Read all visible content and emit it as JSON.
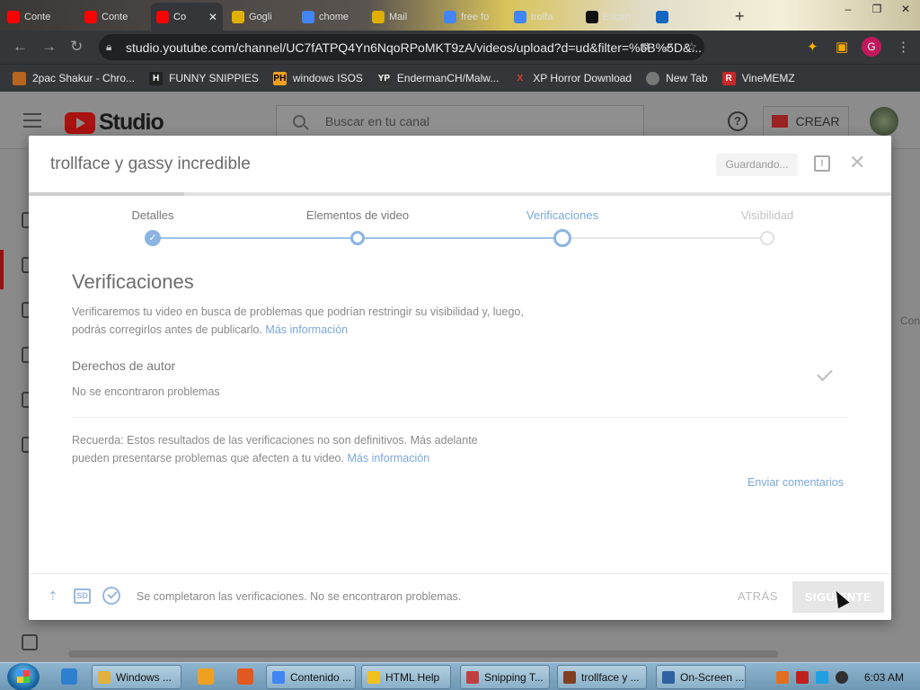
{
  "browser": {
    "tabs": [
      {
        "label": "Conte",
        "color": "#ff0000"
      },
      {
        "label": "Conte",
        "color": "#ff0000"
      },
      {
        "label": "Co",
        "color": "#ff0000",
        "active": true
      },
      {
        "label": "Gogli",
        "color": "#e0b000"
      },
      {
        "label": "chome",
        "color": "#4285f4"
      },
      {
        "label": "Mail",
        "color": "#e0b000"
      },
      {
        "label": "free fo",
        "color": "#4285f4"
      },
      {
        "label": "trolfa",
        "color": "#4285f4"
      },
      {
        "label": "Escap",
        "color": "#111111"
      },
      {
        "label": "",
        "color": "#1565c0"
      }
    ],
    "new_tab": "+",
    "window_buttons": {
      "minimize": "–",
      "maximize": "❐",
      "close": "✕"
    },
    "url": "studio.youtube.com/channel/UC7fATPQ4Yn6NqoRPoMKT9zA/videos/upload?d=ud&filter=%5B%5D&...",
    "profile_initial": "G",
    "bookmarks": [
      {
        "label": "2pac Shakur - Chro...",
        "icon": "2pac-icon"
      },
      {
        "label": "FUNNY SNIPPIES",
        "icon": "H"
      },
      {
        "label": "windows ISOS",
        "icon": "PH"
      },
      {
        "label": "EndermanCH/Malw...",
        "icon": "YP"
      },
      {
        "label": "XP Horror Download",
        "icon": "X"
      },
      {
        "label": "New Tab",
        "icon": "globe-icon"
      },
      {
        "label": "VineMEMZ",
        "icon": "R"
      }
    ]
  },
  "studio": {
    "logo_text": "Studio",
    "search_placeholder": "Buscar en tu canal",
    "help": "?",
    "create_label": "CREAR",
    "right_fragment": "Con"
  },
  "modal": {
    "title": "trollface y gassy incredible",
    "saving": "Guardando...",
    "report": "!",
    "close": "✕",
    "progress_fraction": 0.18,
    "steps": [
      {
        "label": "Detalles",
        "state": "done"
      },
      {
        "label": "Elementos de video",
        "state": "done"
      },
      {
        "label": "Verificaciones",
        "state": "current"
      },
      {
        "label": "Visibilidad",
        "state": "todo"
      }
    ],
    "heading": "Verificaciones",
    "intro_line1": "Verificaremos tu video en busca de problemas que podrían restringir su visibilidad y, luego,",
    "intro_line2": "podrás corregirlos antes de publicarlo.",
    "intro_link": "Más información",
    "copyright_title": "Derechos de autor",
    "copyright_status": "No se encontraron problemas",
    "note_line1": "Recuerda: Estos resultados de las verificaciones no son definitivos. Más adelante",
    "note_line2": "pueden presentarse problemas que afecten a tu video.",
    "note_link": "Más información",
    "feedback": "Enviar comentarios",
    "footer_sd": "SD",
    "footer_status": "Se completaron las verificaciones. No se encontraron problemas.",
    "back": "ATRÁS",
    "next": "SIGUIENTE"
  },
  "taskbar": {
    "tasks": [
      {
        "label": "Windows ...",
        "color": "#e0b040"
      },
      {
        "label": "Contenido ...",
        "color": "#4285f4"
      },
      {
        "label": "HTML Help",
        "color": "#f0c020"
      },
      {
        "label": "Snipping T...",
        "color": "#c04040"
      },
      {
        "label": "trollface y ...",
        "color": "#804020"
      },
      {
        "label": "On-Screen ...",
        "color": "#3060a0"
      }
    ],
    "clock": "6:03 AM"
  }
}
